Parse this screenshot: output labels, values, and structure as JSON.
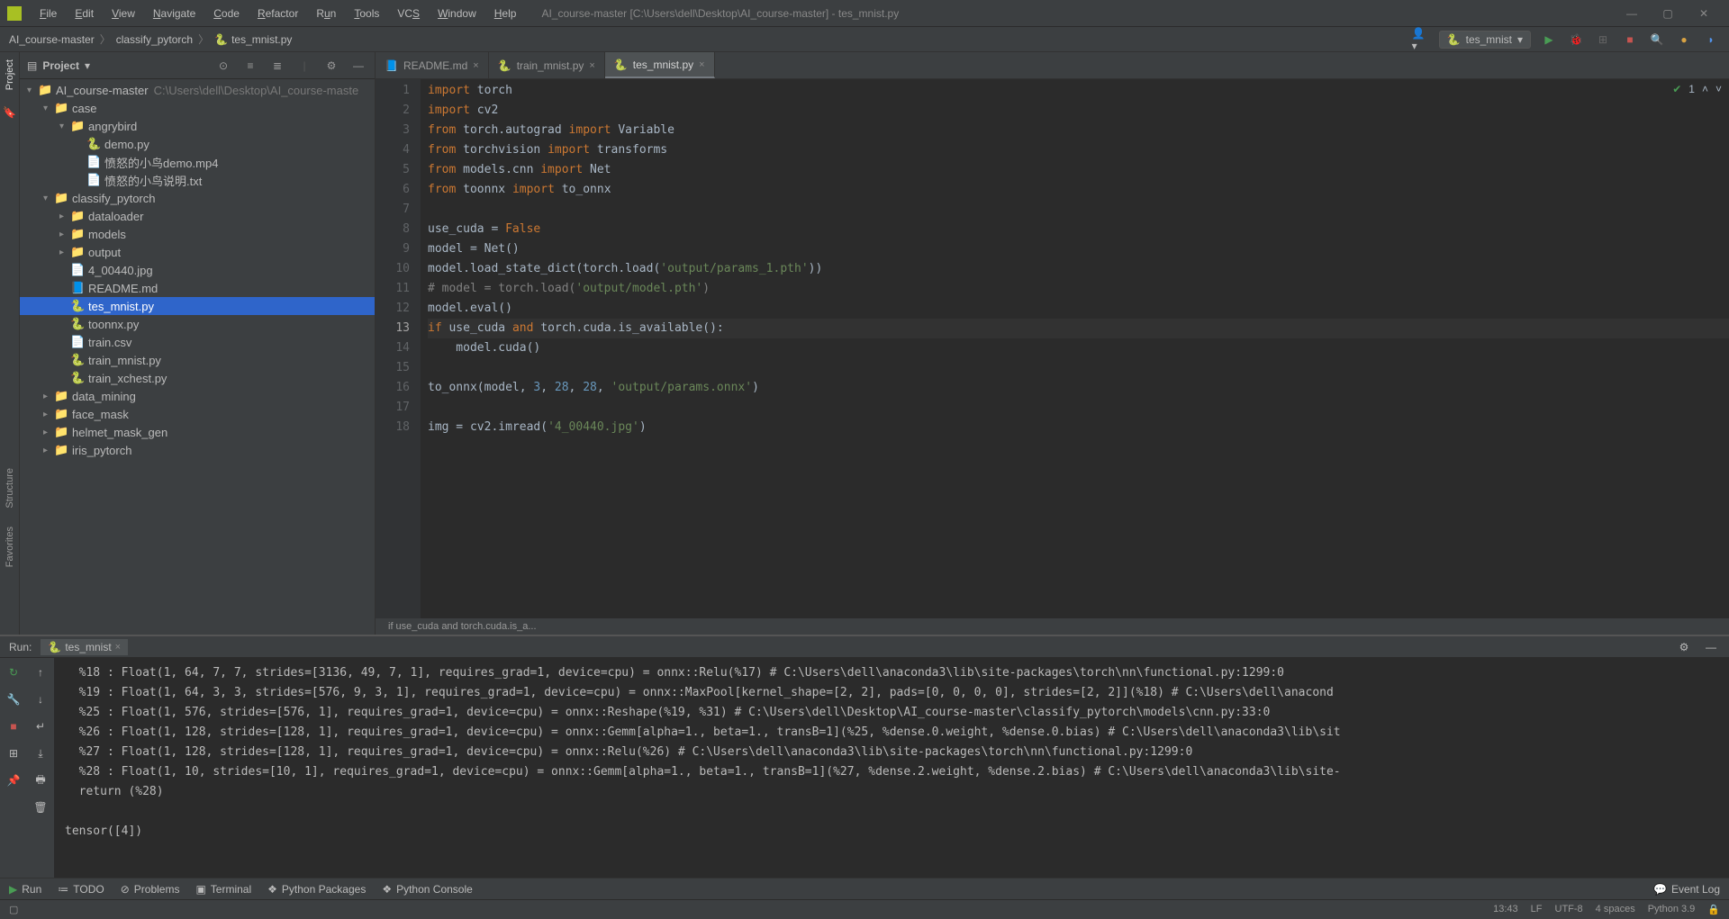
{
  "title": "AI_course-master [C:\\Users\\dell\\Desktop\\AI_course-master] - tes_mnist.py",
  "menus": [
    "File",
    "Edit",
    "View",
    "Navigate",
    "Code",
    "Refactor",
    "Run",
    "Tools",
    "VCS",
    "Window",
    "Help"
  ],
  "breadcrumbs": [
    "AI_course-master",
    "classify_pytorch",
    "tes_mnist.py"
  ],
  "run_config": "tes_mnist",
  "project_panel": {
    "title": "Project",
    "root": {
      "name": "AI_course-master",
      "path": "C:\\Users\\dell\\Desktop\\AI_course-master"
    },
    "tree": [
      {
        "indent": 0,
        "arrow": "▾",
        "icon": "folder-root",
        "label": "AI_course-master",
        "suffix": " C:\\Users\\dell\\Desktop\\AI_course-maste"
      },
      {
        "indent": 1,
        "arrow": "▾",
        "icon": "folder",
        "label": "case"
      },
      {
        "indent": 2,
        "arrow": "▾",
        "icon": "folder",
        "label": "angrybird"
      },
      {
        "indent": 3,
        "arrow": "",
        "icon": "py",
        "label": "demo.py"
      },
      {
        "indent": 3,
        "arrow": "",
        "icon": "file",
        "label": "愤怒的小鸟demo.mp4"
      },
      {
        "indent": 3,
        "arrow": "",
        "icon": "file",
        "label": "愤怒的小鸟说明.txt"
      },
      {
        "indent": 1,
        "arrow": "▾",
        "icon": "folder",
        "label": "classify_pytorch"
      },
      {
        "indent": 2,
        "arrow": "▸",
        "icon": "folder",
        "label": "dataloader"
      },
      {
        "indent": 2,
        "arrow": "▸",
        "icon": "folder",
        "label": "models"
      },
      {
        "indent": 2,
        "arrow": "▸",
        "icon": "folder",
        "label": "output"
      },
      {
        "indent": 2,
        "arrow": "",
        "icon": "file",
        "label": "4_00440.jpg"
      },
      {
        "indent": 2,
        "arrow": "",
        "icon": "md",
        "label": "README.md"
      },
      {
        "indent": 2,
        "arrow": "",
        "icon": "py",
        "label": "tes_mnist.py",
        "selected": true
      },
      {
        "indent": 2,
        "arrow": "",
        "icon": "py",
        "label": "toonnx.py"
      },
      {
        "indent": 2,
        "arrow": "",
        "icon": "file",
        "label": "train.csv"
      },
      {
        "indent": 2,
        "arrow": "",
        "icon": "py",
        "label": "train_mnist.py"
      },
      {
        "indent": 2,
        "arrow": "",
        "icon": "py",
        "label": "train_xchest.py"
      },
      {
        "indent": 1,
        "arrow": "▸",
        "icon": "folder",
        "label": "data_mining"
      },
      {
        "indent": 1,
        "arrow": "▸",
        "icon": "folder",
        "label": "face_mask"
      },
      {
        "indent": 1,
        "arrow": "▸",
        "icon": "folder",
        "label": "helmet_mask_gen"
      },
      {
        "indent": 1,
        "arrow": "▸",
        "icon": "folder",
        "label": "iris_pytorch"
      }
    ]
  },
  "editor": {
    "tabs": [
      {
        "label": "README.md",
        "icon": "md"
      },
      {
        "label": "train_mnist.py",
        "icon": "py"
      },
      {
        "label": "tes_mnist.py",
        "icon": "py",
        "active": true
      }
    ],
    "code_breadcrumb": "if use_cuda and torch.cuda.is_a...",
    "inspection": "1",
    "lines": [
      "import torch",
      "import cv2",
      "from torch.autograd import Variable",
      "from torchvision import transforms",
      "from models.cnn import Net",
      "from toonnx import to_onnx",
      "",
      "use_cuda = False",
      "model = Net()",
      "model.load_state_dict(torch.load('output/params_1.pth'))",
      "# model = torch.load('output/model.pth')",
      "model.eval()",
      "if use_cuda and torch.cuda.is_available():",
      "    model.cuda()",
      "",
      "to_onnx(model, 3, 28, 28, 'output/params.onnx')",
      "",
      "img = cv2.imread('4_00440.jpg')"
    ],
    "current_line": 13
  },
  "run": {
    "label": "Run:",
    "tab": "tes_mnist",
    "output": [
      "  %18 : Float(1, 64, 7, 7, strides=[3136, 49, 7, 1], requires_grad=1, device=cpu) = onnx::Relu(%17) # C:\\Users\\dell\\anaconda3\\lib\\site-packages\\torch\\nn\\functional.py:1299:0",
      "  %19 : Float(1, 64, 3, 3, strides=[576, 9, 3, 1], requires_grad=1, device=cpu) = onnx::MaxPool[kernel_shape=[2, 2], pads=[0, 0, 0, 0], strides=[2, 2]](%18) # C:\\Users\\dell\\anacond",
      "  %25 : Float(1, 576, strides=[576, 1], requires_grad=1, device=cpu) = onnx::Reshape(%19, %31) # C:\\Users\\dell\\Desktop\\AI_course-master\\classify_pytorch\\models\\cnn.py:33:0",
      "  %26 : Float(1, 128, strides=[128, 1], requires_grad=1, device=cpu) = onnx::Gemm[alpha=1., beta=1., transB=1](%25, %dense.0.weight, %dense.0.bias) # C:\\Users\\dell\\anaconda3\\lib\\sit",
      "  %27 : Float(1, 128, strides=[128, 1], requires_grad=1, device=cpu) = onnx::Relu(%26) # C:\\Users\\dell\\anaconda3\\lib\\site-packages\\torch\\nn\\functional.py:1299:0",
      "  %28 : Float(1, 10, strides=[10, 1], requires_grad=1, device=cpu) = onnx::Gemm[alpha=1., beta=1., transB=1](%27, %dense.2.weight, %dense.2.bias) # C:\\Users\\dell\\anaconda3\\lib\\site-",
      "  return (%28)",
      "",
      "tensor([4])"
    ]
  },
  "bottom_tools": [
    "Run",
    "TODO",
    "Problems",
    "Terminal",
    "Python Packages",
    "Python Console"
  ],
  "event_log": "Event Log",
  "status": {
    "time": "13:43",
    "line_sep": "LF",
    "encoding": "UTF-8",
    "indent": "4 spaces",
    "interpreter": "Python 3.9"
  },
  "rails": {
    "project": "Project",
    "structure": "Structure",
    "favorites": "Favorites"
  }
}
